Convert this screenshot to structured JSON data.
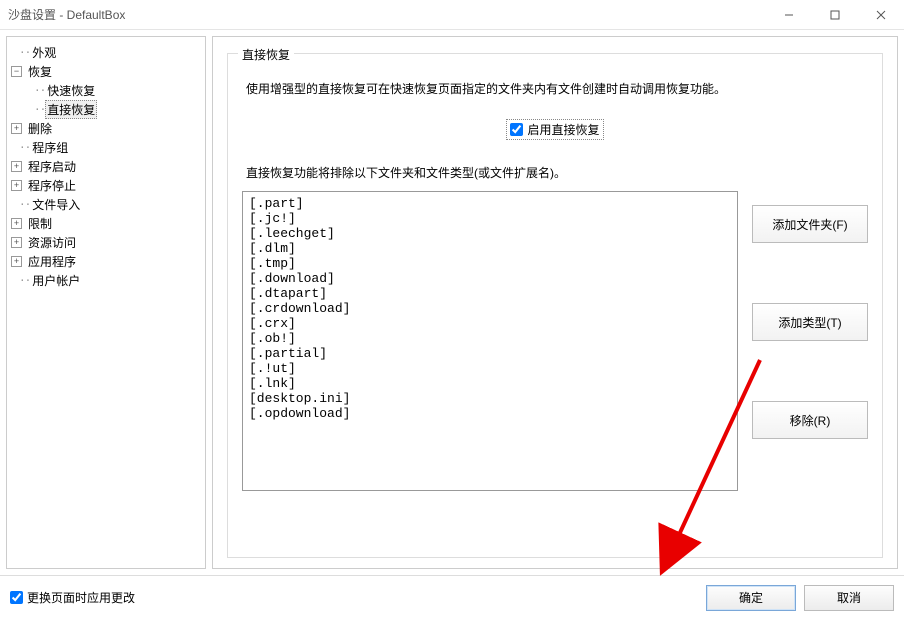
{
  "title": "沙盘设置 - DefaultBox",
  "tree": {
    "items": [
      {
        "label": "外观",
        "expand": null,
        "depth": 0
      },
      {
        "label": "恢复",
        "expand": "minus",
        "depth": 0
      },
      {
        "label": "快速恢复",
        "expand": null,
        "depth": 1
      },
      {
        "label": "直接恢复",
        "expand": null,
        "depth": 1,
        "selected": true
      },
      {
        "label": "删除",
        "expand": "plus",
        "depth": 0
      },
      {
        "label": "程序组",
        "expand": null,
        "depth": 0
      },
      {
        "label": "程序启动",
        "expand": "plus",
        "depth": 0
      },
      {
        "label": "程序停止",
        "expand": "plus",
        "depth": 0
      },
      {
        "label": "文件导入",
        "expand": null,
        "depth": 0
      },
      {
        "label": "限制",
        "expand": "plus",
        "depth": 0
      },
      {
        "label": "资源访问",
        "expand": "plus",
        "depth": 0
      },
      {
        "label": "应用程序",
        "expand": "plus",
        "depth": 0
      },
      {
        "label": "用户帐户",
        "expand": null,
        "depth": 0
      }
    ]
  },
  "panel": {
    "group_title": "直接恢复",
    "desc1": "使用增强型的直接恢复可在快速恢复页面指定的文件夹内有文件创建时自动调用恢复功能。",
    "checkbox_label": "启用直接恢复",
    "checkbox_checked": true,
    "desc2": "直接恢复功能将排除以下文件夹和文件类型(或文件扩展名)。",
    "list_items": [
      "[.part]",
      "[.jc!]",
      "[.leechget]",
      "[.dlm]",
      "[.tmp]",
      "[.download]",
      "[.dtapart]",
      "[.crdownload]",
      "[.crx]",
      "[.ob!]",
      "[.partial]",
      "[.!ut]",
      "[.lnk]",
      "[desktop.ini]",
      "[.opdownload]"
    ],
    "btn_add_folder": "添加文件夹(F)",
    "btn_add_type": "添加类型(T)",
    "btn_remove": "移除(R)"
  },
  "bottom": {
    "apply_on_nav": "更换页面时应用更改",
    "ok": "确定",
    "cancel": "取消"
  }
}
